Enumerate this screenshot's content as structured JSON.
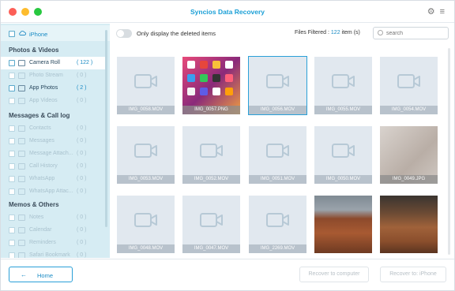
{
  "window": {
    "title": "Syncios Data Recovery"
  },
  "titlebar": {
    "gear_icon": "gear-icon",
    "menu_icon": "menu-icon"
  },
  "sidebar": {
    "device": {
      "name": "iPhone",
      "icon": "cloud-icon"
    },
    "groups": [
      {
        "title": "Photos & Videos",
        "items": [
          {
            "label": "Camera Roll",
            "count": "( 122 )",
            "selected": true,
            "enabled": true,
            "icon": "camera-icon"
          },
          {
            "label": "Photo Stream",
            "count": "( 0 )",
            "selected": false,
            "enabled": false,
            "icon": "stream-icon"
          },
          {
            "label": "App Photos",
            "count": "( 2 )",
            "selected": false,
            "enabled": true,
            "icon": "image-icon"
          },
          {
            "label": "App Videos",
            "count": "( 0 )",
            "selected": false,
            "enabled": false,
            "icon": "video-icon"
          }
        ]
      },
      {
        "title": "Messages & Call log",
        "items": [
          {
            "label": "Contacts",
            "count": "( 0 )",
            "enabled": false,
            "icon": "contacts-icon"
          },
          {
            "label": "Messages",
            "count": "( 0 )",
            "enabled": false,
            "icon": "message-icon"
          },
          {
            "label": "Message Attach...",
            "count": "( 0 )",
            "enabled": false,
            "icon": "attachment-icon"
          },
          {
            "label": "Call History",
            "count": "( 0 )",
            "enabled": false,
            "icon": "phone-icon"
          },
          {
            "label": "WhatsApp",
            "count": "( 0 )",
            "enabled": false,
            "icon": "whatsapp-icon"
          },
          {
            "label": "WhatsApp Attac...",
            "count": "( 0 )",
            "enabled": false,
            "icon": "whatsapp-attachment-icon"
          }
        ]
      },
      {
        "title": "Memos & Others",
        "items": [
          {
            "label": "Notes",
            "count": "( 0 )",
            "enabled": false,
            "icon": "notes-icon"
          },
          {
            "label": "Calendar",
            "count": "( 0 )",
            "enabled": false,
            "icon": "calendar-icon"
          },
          {
            "label": "Reminders",
            "count": "( 0 )",
            "enabled": false,
            "icon": "reminder-icon"
          },
          {
            "label": "Safari Bookmark",
            "count": "( 0 )",
            "enabled": false,
            "icon": "bookmark-icon"
          }
        ]
      }
    ]
  },
  "toolbar": {
    "toggle_label": "Only display the deleted items",
    "filter_prefix": "Files Filtered : ",
    "filter_count": "122",
    "filter_suffix": " item (s)",
    "search_placeholder": "search"
  },
  "grid": {
    "tiles": [
      {
        "name": "IMG_0058.MOV",
        "kind": "video"
      },
      {
        "name": "IMG_0057.PNG",
        "kind": "phone-screenshot"
      },
      {
        "name": "IMG_0056.MOV",
        "kind": "video",
        "selected": true
      },
      {
        "name": "IMG_0055.MOV",
        "kind": "video"
      },
      {
        "name": "IMG_0054.MOV",
        "kind": "video"
      },
      {
        "name": "IMG_0053.MOV",
        "kind": "video"
      },
      {
        "name": "IMG_0052.MOV",
        "kind": "video"
      },
      {
        "name": "IMG_0051.MOV",
        "kind": "video"
      },
      {
        "name": "IMG_0050.MOV",
        "kind": "video"
      },
      {
        "name": "IMG_0049.JPG",
        "kind": "blurred-photo"
      },
      {
        "name": "IMG_0048.MOV",
        "kind": "video"
      },
      {
        "name": "IMG_0047.MOV",
        "kind": "video"
      },
      {
        "name": "IMG_2269.MOV",
        "kind": "video"
      },
      {
        "name": "",
        "kind": "landscape-photo"
      },
      {
        "name": "",
        "kind": "landscape-photo-2"
      }
    ]
  },
  "footer": {
    "home_label": "Home",
    "recover_computer_label": "Recover to computer",
    "recover_iphone_label": "Recover to: iPhone"
  },
  "colors": {
    "accent": "#1a8bc4",
    "sidebar_bg": "#d6ecf3"
  }
}
